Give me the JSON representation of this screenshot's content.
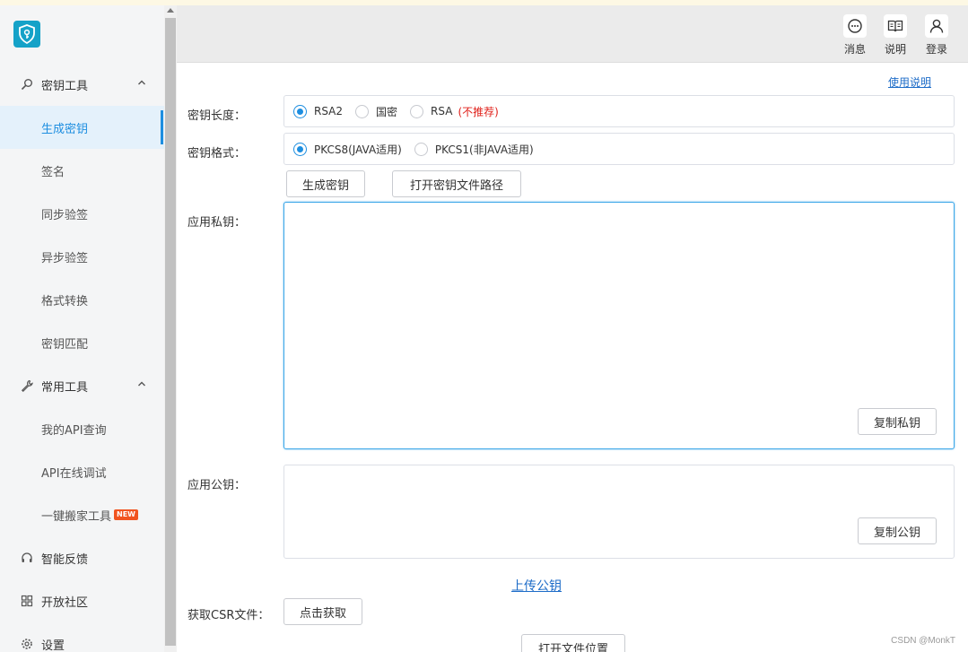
{
  "colors": {
    "accent": "#1d8ee0",
    "logo_bg": "#15a2c8",
    "warn": "#e0201a",
    "badge": "#f1531f"
  },
  "sidebar": {
    "logo_icon": "shield-key-icon",
    "groups": [
      {
        "label": "密钥工具",
        "icon": "key-search-icon",
        "items": [
          "生成密钥",
          "签名",
          "同步验签",
          "异步验签",
          "格式转换",
          "密钥匹配"
        ]
      },
      {
        "label": "常用工具",
        "icon": "wrench-icon",
        "items": [
          "我的API查询",
          "API在线调试",
          "一键搬家工具"
        ]
      }
    ],
    "new_badge": "NEW",
    "bottom": [
      "智能反馈",
      "开放社区",
      "设置"
    ],
    "active": "生成密钥"
  },
  "header": {
    "buttons": [
      "消息",
      "说明",
      "登录"
    ]
  },
  "main": {
    "help_link": "使用说明",
    "key_length": {
      "label": "密钥长度：",
      "options": [
        "RSA2",
        "国密",
        "RSA"
      ],
      "warning": "(不推荐)",
      "selected": "RSA2"
    },
    "key_format": {
      "label": "密钥格式：",
      "options": [
        "PKCS8(JAVA适用)",
        "PKCS1(非JAVA适用)"
      ],
      "selected": "PKCS8(JAVA适用)"
    },
    "generate_button": "生成密钥",
    "open_path_button": "打开密钥文件路径",
    "private_key": {
      "label": "应用私钥：",
      "value": "",
      "copy_button": "复制私钥"
    },
    "public_key": {
      "label": "应用公钥：",
      "value": "",
      "copy_button": "复制公钥"
    },
    "upload_link": "上传公钥",
    "csr": {
      "label": "获取CSR文件：",
      "button": "点击获取"
    },
    "open_location_button": "打开文件位置"
  },
  "watermark": "CSDN @MonkT"
}
